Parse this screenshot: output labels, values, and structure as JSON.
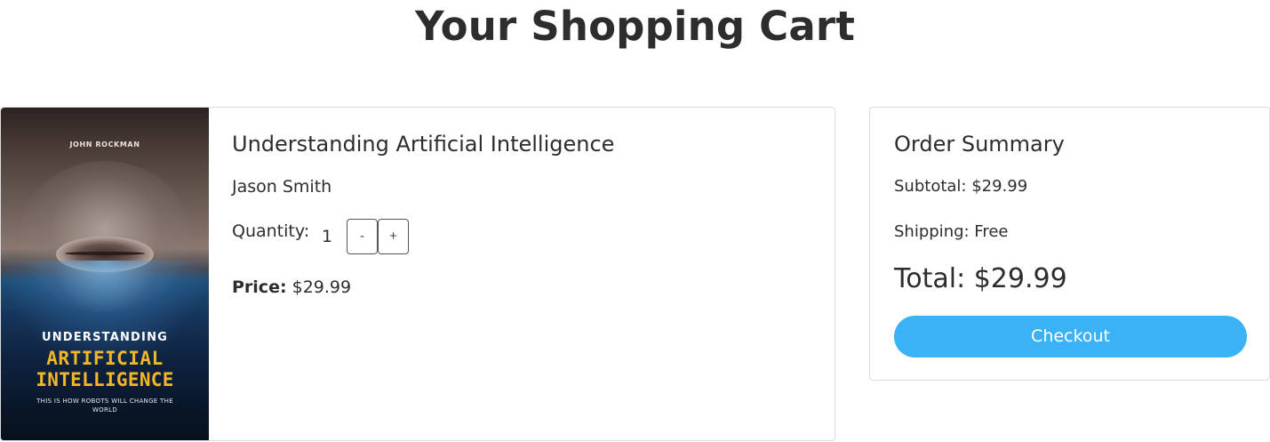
{
  "page": {
    "title": "Your Shopping Cart"
  },
  "cart": {
    "items": [
      {
        "title": "Understanding Artificial Intelligence",
        "author": "Jason Smith",
        "quantity_label": "Quantity:",
        "quantity": "1",
        "decrement_label": "-",
        "increment_label": "+",
        "price_label": "Price:",
        "price": "$29.99",
        "cover": {
          "author": "JOHN ROCKMAN",
          "line1": "UNDERSTANDING",
          "line2": "ARTIFICIAL",
          "line3": "INTELLIGENCE",
          "tagline": "THIS IS HOW ROBOTS WILL CHANGE THE WORLD"
        }
      }
    ]
  },
  "summary": {
    "title": "Order Summary",
    "subtotal": "Subtotal: $29.99",
    "shipping": "Shipping: Free",
    "total": "Total: $29.99",
    "checkout_label": "Checkout"
  },
  "colors": {
    "accent": "#3bb2f6",
    "text": "#2d2d2d",
    "cover_title_gold": "#f4b629"
  }
}
